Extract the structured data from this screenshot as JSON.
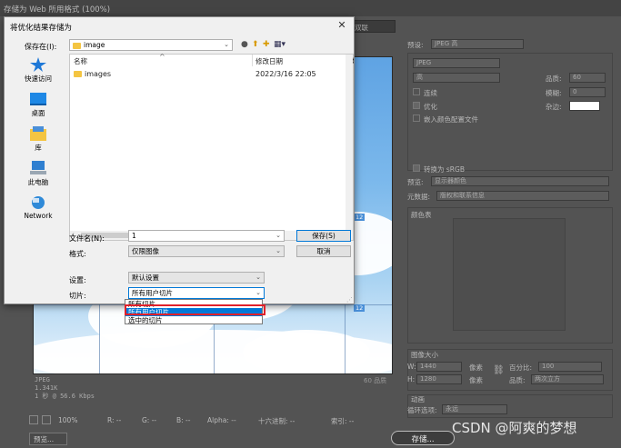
{
  "window": {
    "title": "存储为 Web 所用格式 (100%)",
    "tab_label": "双联"
  },
  "preview": {
    "slice_badge_1": "12",
    "slice_badge_2": "12"
  },
  "info": {
    "format": "JPEG",
    "size": "1.341K",
    "time": "1 秒 @ 56.6 Kbps",
    "quality_label": "60 品质"
  },
  "status_bar": {
    "zoom": "100%",
    "r_label": "R: --",
    "g_label": "G: --",
    "b_label": "B: --",
    "alpha_label": "Alpha: --",
    "hex_label": "十六进制: --",
    "index_label": "索引: --"
  },
  "bottom": {
    "preview_button": "预览...",
    "save_button": "存储..."
  },
  "right_panel": {
    "preset_label": "预设:",
    "preset_value": "JPEG 高",
    "format_value": "JPEG",
    "quality_level": "高",
    "quality_label": "品质:",
    "quality_value": "60",
    "progressive_label": "连续",
    "blur_label": "模糊:",
    "blur_value": "0",
    "optimized_label": "优化",
    "matte_label": "杂边:",
    "embed_profile_label": "嵌入颜色配置文件",
    "convert_srgb_label": "转换为 sRGB",
    "preview_label": "预览:",
    "preview_value": "显示器颜色",
    "metadata_label": "元数据:",
    "metadata_value": "版权和联系信息",
    "color_table_label": "颜色表",
    "image_size_label": "图像大小",
    "w_label": "W:",
    "w_value": "1440",
    "px_label": "像素",
    "h_label": "H:",
    "h_value": "1280",
    "percent_label": "百分比:",
    "percent_value": "100",
    "quality2_label": "品质:",
    "quality2_value": "两次立方",
    "animation_label": "动画",
    "loop_label": "循环选项:",
    "loop_value": "永远"
  },
  "dialog": {
    "title": "将优化结果存储为",
    "save_in_label": "保存在(I):",
    "save_in_value": "image",
    "places": [
      "快速访问",
      "桌面",
      "库",
      "此电脑",
      "Network"
    ],
    "columns": [
      "名称",
      "修改日期",
      "类"
    ],
    "files": [
      {
        "name": "images",
        "date": "2022/3/16 22:05"
      }
    ],
    "filename_label": "文件名(N):",
    "filename_value": "1",
    "format_label": "格式:",
    "format_value": "仅限图像",
    "save_button": "保存(S)",
    "cancel_button": "取消",
    "settings_label": "设置:",
    "settings_value": "默认设置",
    "slices_label": "切片:",
    "slices_value": "所有用户切片",
    "slice_options": [
      "所有切片",
      "所有用户切片",
      "选中的切片"
    ],
    "selected_option_index": 1
  },
  "watermark": "CSDN @阿爽的梦想"
}
